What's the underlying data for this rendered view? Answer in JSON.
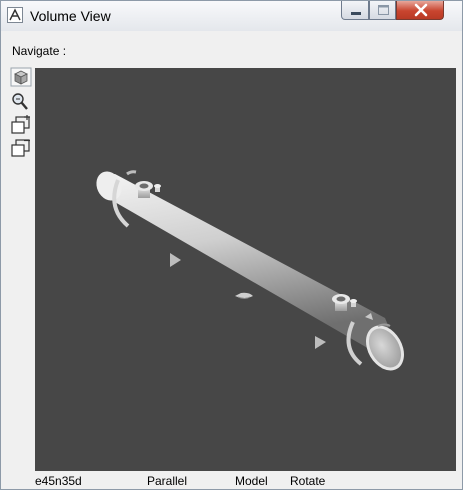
{
  "window": {
    "title": "Volume View"
  },
  "navigate": {
    "label": "Navigate :"
  },
  "toolbar": {
    "tools": [
      {
        "icon": "view-cube-icon"
      },
      {
        "icon": "zoom-icon"
      },
      {
        "icon": "zoom-in-window-icon"
      },
      {
        "icon": "zoom-out-window-icon"
      }
    ]
  },
  "viewport": {
    "background": "#474747",
    "object": "cylindrical-vessel-model"
  },
  "status": {
    "view_direction": "e45n35d",
    "projection": "Parallel",
    "mode": "Model",
    "action": "Rotate"
  }
}
